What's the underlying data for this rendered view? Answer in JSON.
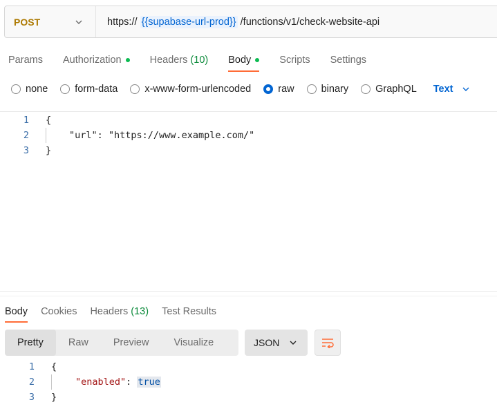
{
  "request": {
    "method": "POST",
    "url_prefix": "https://",
    "url_variable": "{{supabase-url-prod}}",
    "url_suffix": "/functions/v1/check-website-api"
  },
  "request_tabs": [
    {
      "label": "Params",
      "active": false
    },
    {
      "label": "Authorization",
      "active": false,
      "dot": true
    },
    {
      "label": "Headers",
      "count": "(10)",
      "active": false
    },
    {
      "label": "Body",
      "active": true,
      "dot": true
    },
    {
      "label": "Scripts",
      "active": false
    },
    {
      "label": "Settings",
      "active": false
    }
  ],
  "body_types": {
    "options": [
      "none",
      "form-data",
      "x-www-form-urlencoded",
      "raw",
      "binary",
      "GraphQL"
    ],
    "selected": "raw",
    "format": "Text"
  },
  "request_body": {
    "line_numbers": [
      "1",
      "2",
      "3"
    ],
    "line1": "{",
    "line2_key": "\"url\"",
    "line2_sep": ": ",
    "line2_value": "\"https://www.example.com/\"",
    "line3": "}"
  },
  "response_tabs": [
    {
      "label": "Body",
      "active": true
    },
    {
      "label": "Cookies",
      "active": false
    },
    {
      "label": "Headers",
      "count": "(13)",
      "active": false
    },
    {
      "label": "Test Results",
      "active": false
    }
  ],
  "view_modes": [
    "Pretty",
    "Raw",
    "Preview",
    "Visualize"
  ],
  "view_selected": "Pretty",
  "response_format": "JSON",
  "response_body": {
    "line_numbers": [
      "1",
      "2",
      "3"
    ],
    "line1": "{",
    "line2_key": "\"enabled\"",
    "line2_sep": ": ",
    "line2_value": "true",
    "line3": "}"
  },
  "colors": {
    "accent": "#ff6c37",
    "method": "#ad7a03",
    "variable": "#0265d2",
    "dot": "#0cbb52"
  }
}
